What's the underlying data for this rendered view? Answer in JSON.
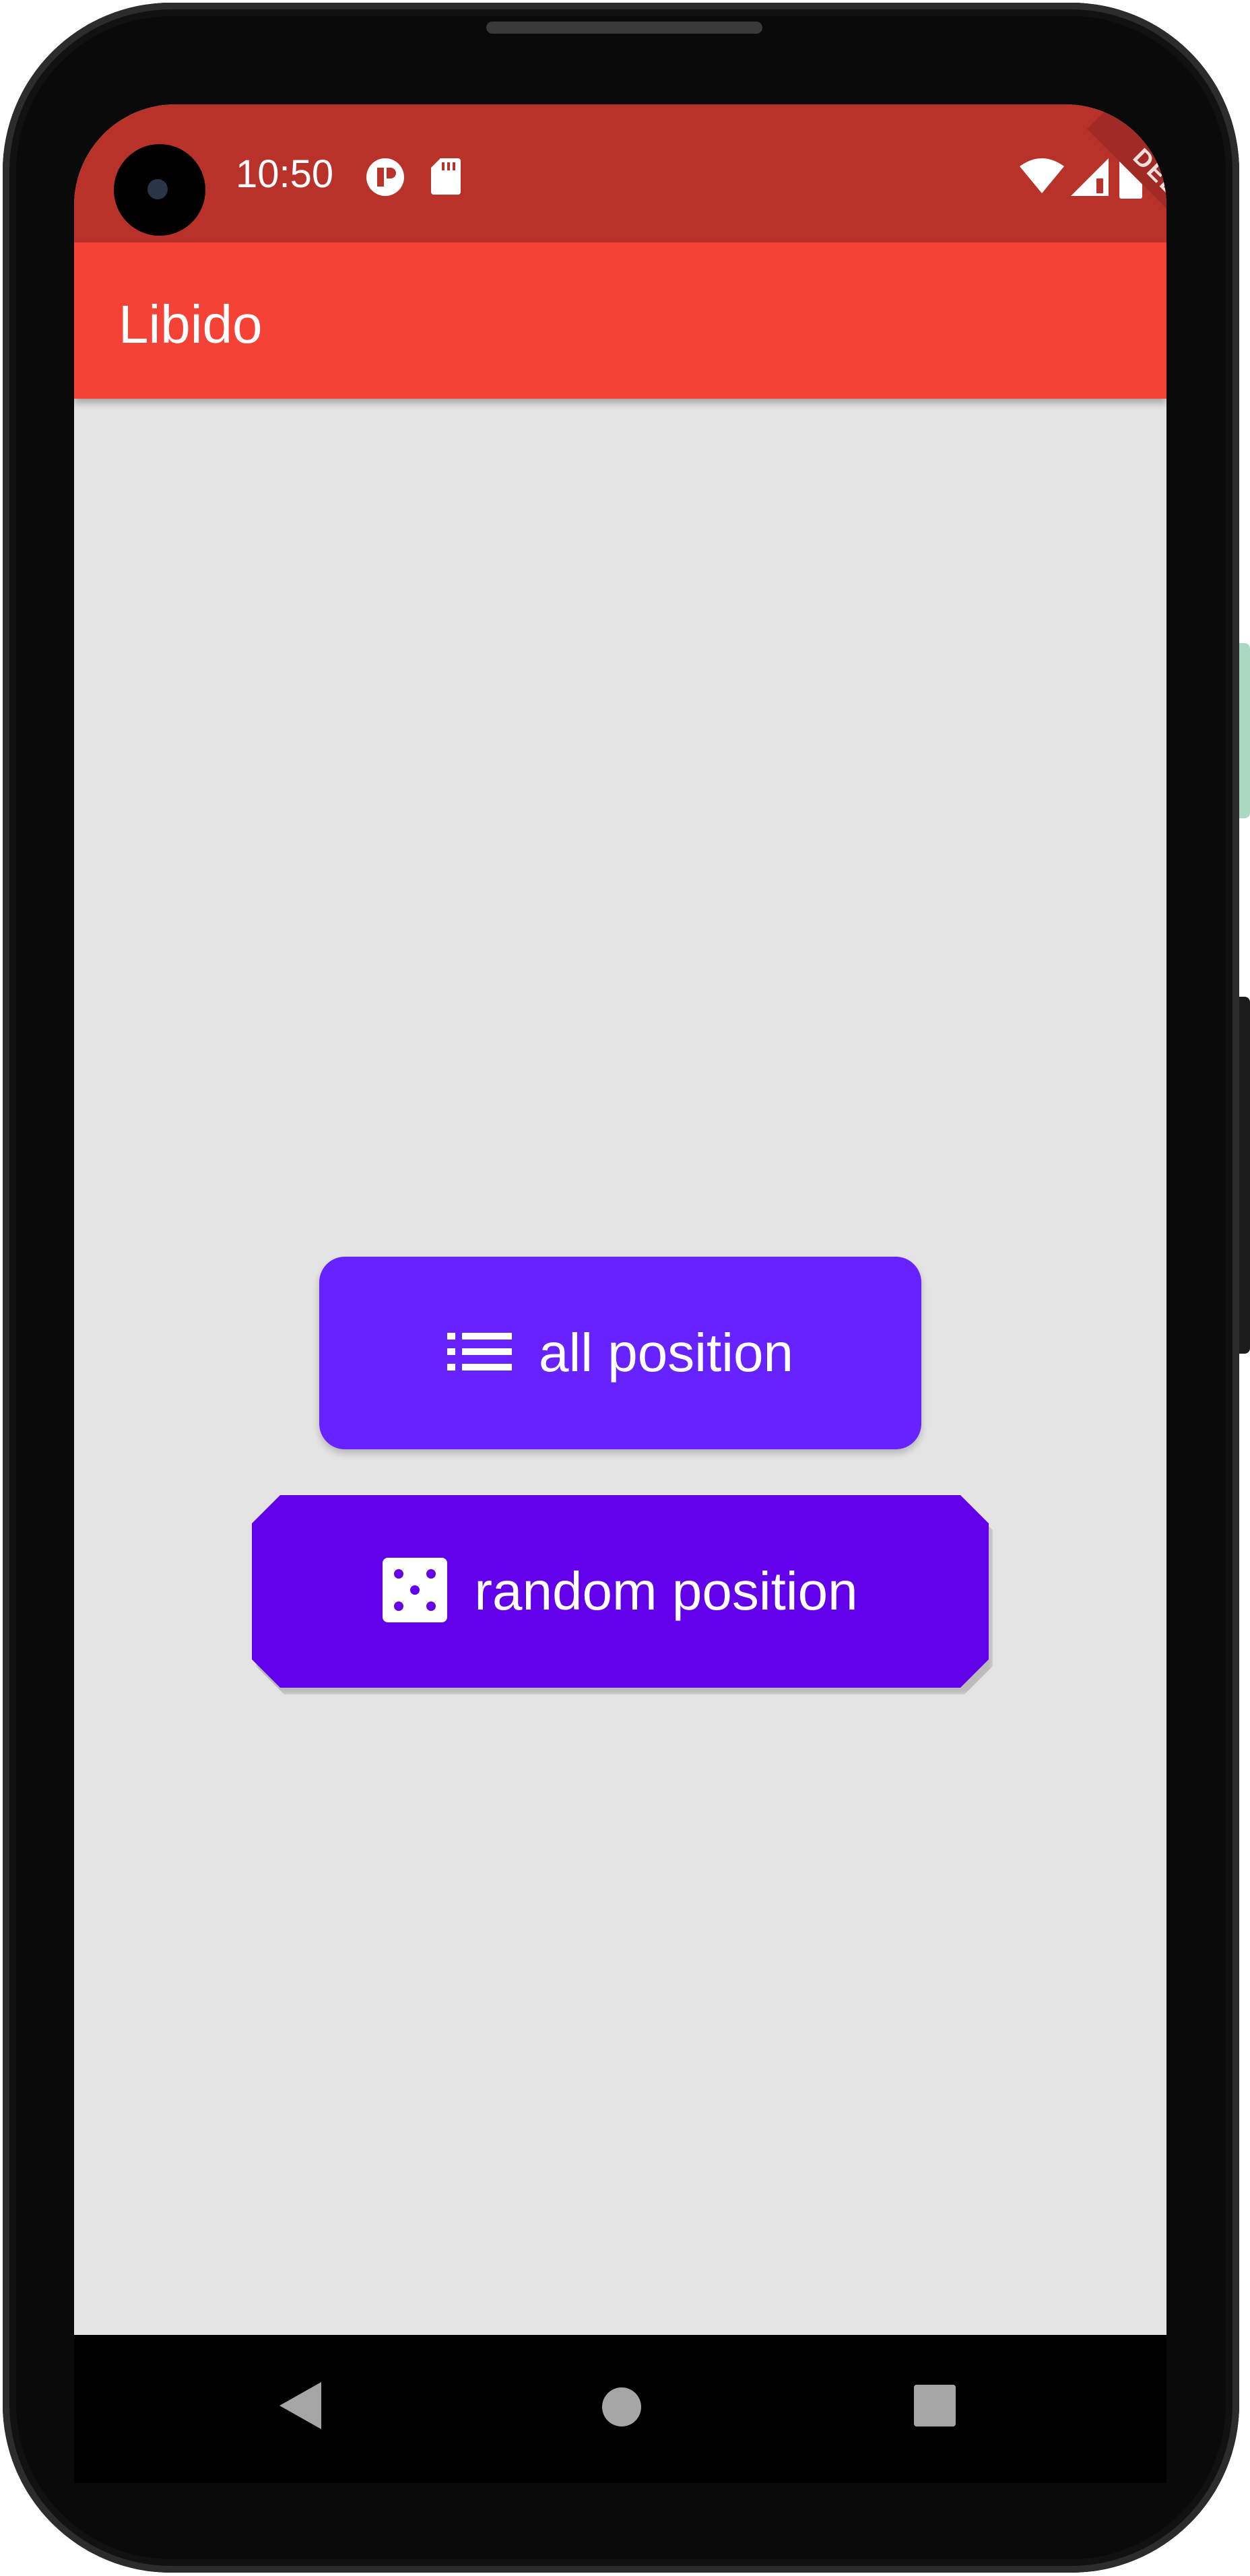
{
  "status_bar": {
    "time": "10:50",
    "icons": [
      "notification-icon",
      "sd-card-icon",
      "wifi-icon",
      "signal-icon",
      "battery-icon"
    ]
  },
  "debug_banner": "DEBUG",
  "app_bar": {
    "title": "Libido"
  },
  "buttons": {
    "all_position": {
      "label": "all position",
      "icon": "list-icon"
    },
    "random_position": {
      "label": "random position",
      "icon": "dice-icon"
    }
  },
  "nav_bar": {
    "items": [
      "back-icon",
      "home-icon",
      "recents-icon"
    ]
  },
  "colors": {
    "status_bar": "#b93229",
    "app_bar": "#f44336",
    "background": "#e4e4e4",
    "button_all": "#6723ff",
    "button_random": "#6200ea"
  }
}
